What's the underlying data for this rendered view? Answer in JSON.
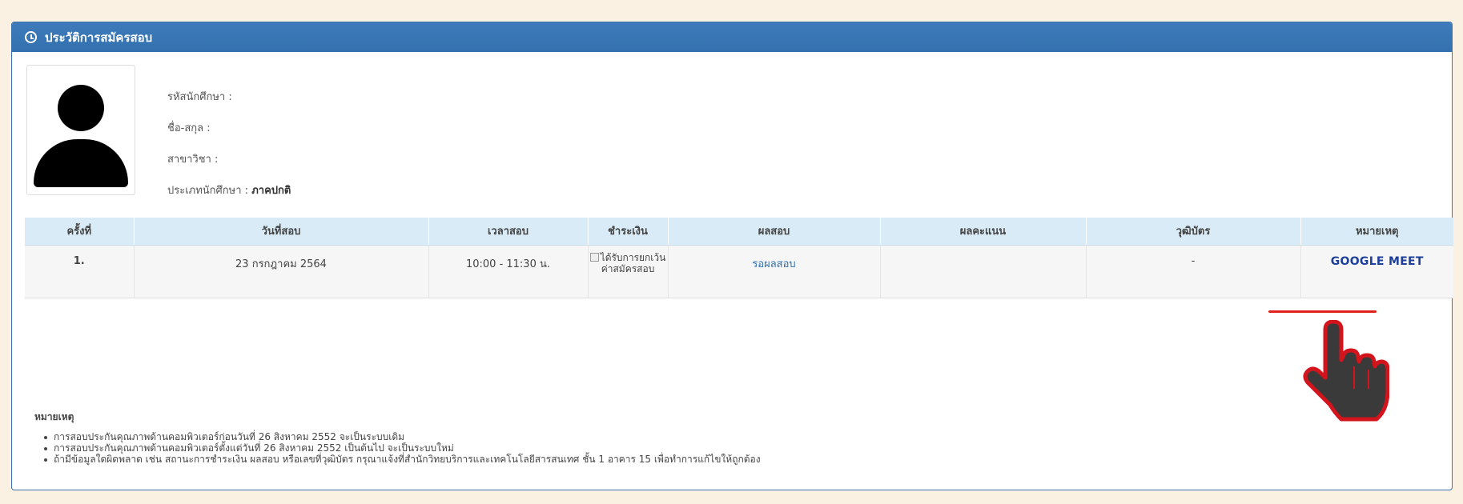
{
  "panel": {
    "title": "ประวัติการสมัครสอบ"
  },
  "student": {
    "id_label": "รหัสนักศึกษา :",
    "name_label": "ชื่อ-สกุล :",
    "major_label": "สาขาวิชา :",
    "type_label": "ประเภทนักศึกษา :",
    "type_value": "ภาคปกติ"
  },
  "table": {
    "headers": [
      "ครั้งที่",
      "วันที่สอบ",
      "เวลาสอบ",
      "ชำระเงิน",
      "ผลสอบ",
      "ผลคะแนน",
      "วุฒิบัตร",
      "หมายเหตุ"
    ],
    "rows": [
      {
        "no": "1.",
        "date": "23 กรกฎาคม 2564",
        "time": "10:00 - 11:30 น.",
        "payment": "ได้รับการยกเว้นค่าสมัครสอบ",
        "result": "รอผลสอบ",
        "score": "",
        "certificate": "-",
        "note_link": "GOOGLE MEET"
      }
    ]
  },
  "notes": {
    "title": "หมายเหตุ",
    "items": [
      "การสอบประกันคุณภาพด้านคอมพิวเตอร์ก่อนวันที่ 26 สิงหาคม 2552 จะเป็นระบบเดิม",
      "การสอบประกันคุณภาพด้านคอมพิวเตอร์ตั้งแต่วันที่ 26 สิงหาคม 2552 เป็นต้นไป จะเป็นระบบใหม่",
      "ถ้ามีข้อมูลใดผิดพลาด เช่น สถานะการชำระเงิน ผลสอบ หรือเลขที่วุฒิบัตร กรุณาแจ้งที่สำนักวิทยบริการและเทคโนโลยีสารสนเทศ ชั้น 1 อาคาร 15 เพื่อทำการแก้ไขให้ถูกต้อง"
    ]
  },
  "icons": {
    "heading": "clock-icon",
    "avatar": "user-avatar-icon",
    "pointer": "hand-pointer-icon"
  },
  "colors": {
    "heading_bg": "#3470ae",
    "table_header_bg": "#d8ebf6",
    "link": "#1d3f9a",
    "underline": "#e0201a",
    "page_bg": "#fbf1e2"
  }
}
